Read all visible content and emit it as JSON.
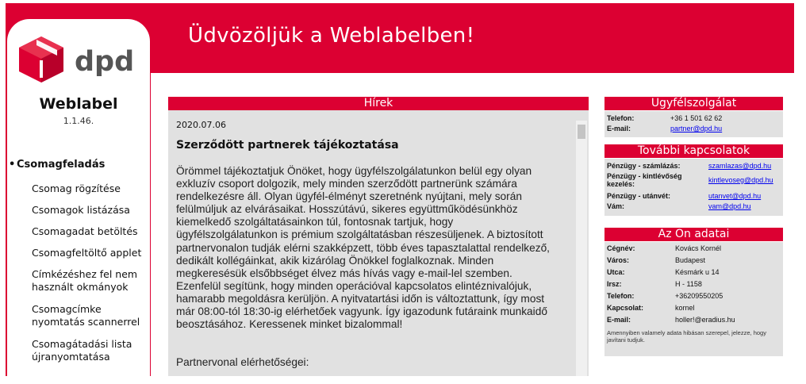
{
  "header": {
    "welcome": "Üdvözöljük a Weblabelben!"
  },
  "sidebar": {
    "brand": "dpd",
    "app_name": "Weblabel",
    "version": "1.1.46.",
    "section": "Csomagfeladás",
    "items": [
      {
        "label": "Csomag rögzítése"
      },
      {
        "label": "Csomagok listázása"
      },
      {
        "label": "Csomagadat betöltés"
      },
      {
        "label": "Csomagfeltöltő applet"
      },
      {
        "label": "Címkézéshez fel nem használt okmányok"
      },
      {
        "label": "Csomagcímke nyomtatás scannerrel"
      },
      {
        "label": "Csomagátadási lista újranyomtatása"
      }
    ]
  },
  "news": {
    "heading": "Hírek",
    "date": "2020.07.06",
    "title": "Szerződött partnerek tájékoztatása",
    "body": "Örömmel tájékoztatjuk Önöket, hogy ügyfélszolgálatunkon belül egy olyan exkluzív csoport dolgozik, mely minden szerződött partnerünk számára rendelkezésre áll. Olyan ügyfél-élményt szeretnénk nyújtani, mely során felülmúljuk az elvárásaikat. Hosszútávú, sikeres együttműködésünkhöz kiemelkedő szolgáltatásainkon túl, fontosnak tartjuk, hogy ügyfélszolgálatunkon is prémium szolgáltatásban részesüljenek. A biztosított partnervonalon tudják elérni szakképzett, több éves tapasztalattal rendelkező, dedikált kollégáinkat, akik kizárólag Önökkel foglalkoznak. Minden megkeresésük elsőbbséget élvez más hívás vagy e-mail-lel szemben. Ezenfelül segítünk, hogy minden operációval kapcsolatos elintéznivalójuk, hamarabb megoldásra kerüljön. A nyitvatartási időn is változtattunk, így most már 08:00-tól 18:30-ig elérhetőek vagyunk. Így igazodunk futáraink munkaidő beosztásához. Keressenek minket bizalommal!",
    "contact_label": "Partnervonal elérhetőségei:"
  },
  "customer_service": {
    "heading": "Ügyfélszolgálat",
    "phone_label": "Telefon:",
    "phone": "+36 1 501 62 62",
    "email_label": "E-mail:",
    "email": "partner@dpd.hu"
  },
  "contacts": {
    "heading": "További kapcsolatok",
    "rows": [
      {
        "label": "Pénzügy - számlázás:",
        "value": "szamlazas@dpd.hu"
      },
      {
        "label": "Pénzügy - kintlévőség kezelés:",
        "value": "kintlevoseg@dpd.hu"
      },
      {
        "label": "Pénzügy - utánvét:",
        "value": "utanvet@dpd.hu"
      },
      {
        "label": "Vám:",
        "value": "vam@dpd.hu"
      }
    ]
  },
  "account": {
    "heading": "Az Ön adatai",
    "rows": [
      {
        "label": "Cégnév:",
        "value": "Kovács Kornél"
      },
      {
        "label": "Város:",
        "value": "Budapest"
      },
      {
        "label": "Utca:",
        "value": "Késmárk u 14"
      },
      {
        "label": "Irsz:",
        "value": "H - 1158"
      },
      {
        "label": "Telefon:",
        "value": "+36209550205"
      },
      {
        "label": "Kapcsolat:",
        "value": "kornel"
      },
      {
        "label": "E-mail:",
        "value": "holler!@eradius.hu"
      }
    ],
    "note": "Amennyiben valamely adata hibásan szerepel, jelezze, hogy javítani tudjuk."
  },
  "colors": {
    "brand_red": "#dc0032",
    "panel_gray": "#e1e1e1",
    "link": "#0000ee"
  }
}
